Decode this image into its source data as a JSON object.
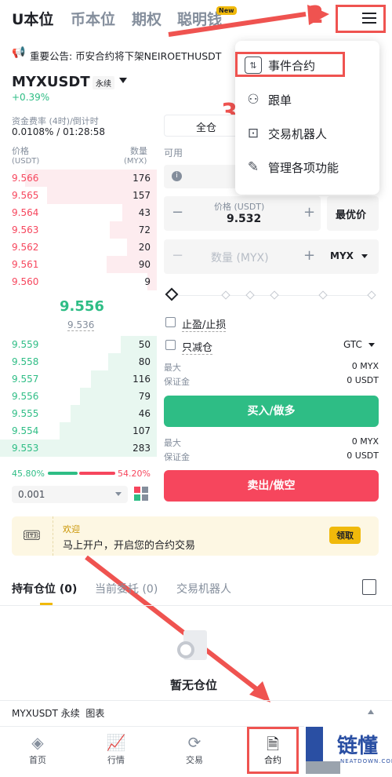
{
  "top_tabs": [
    "U本位",
    "币本位",
    "期权",
    "聪明钱"
  ],
  "new_badge": "New",
  "annotations": [
    "1",
    "2",
    "3"
  ],
  "notice": "重要公告: 币安合约将下架NEIROETHUSDT",
  "symbol": "MYXUSDT",
  "perp_label": "永续",
  "change": "+0.39%",
  "funding_label": "资金费率 (4时)/倒计时",
  "funding_value": "0.0108% / 01:28:58",
  "ob_headers": {
    "price": "价格",
    "price_unit": "(USDT)",
    "qty": "数量",
    "qty_unit": "(MYX)"
  },
  "asks": [
    [
      "9.566",
      "176"
    ],
    [
      "9.565",
      "157"
    ],
    [
      "9.564",
      "43"
    ],
    [
      "9.563",
      "72"
    ],
    [
      "9.562",
      "20"
    ],
    [
      "9.561",
      "90"
    ],
    [
      "9.560",
      "9"
    ]
  ],
  "last_price": "9.556",
  "mark_price": "9.536",
  "bids": [
    [
      "9.559",
      "50"
    ],
    [
      "9.558",
      "80"
    ],
    [
      "9.557",
      "116"
    ],
    [
      "9.556",
      "79"
    ],
    [
      "9.555",
      "46"
    ],
    [
      "9.554",
      "107"
    ],
    [
      "9.553",
      "283"
    ]
  ],
  "ratio": {
    "buy": "45.80%",
    "sell": "54.20%"
  },
  "precision": "0.001",
  "margin_mode": "全仓",
  "available_label": "可用",
  "price_input": {
    "label": "价格 (USDT)",
    "value": "9.532",
    "best": "最优价"
  },
  "qty_input": {
    "placeholder": "数量 (MYX)",
    "unit": "MYX"
  },
  "tpsl": "止盈/止损",
  "reduce_only": "只减仓",
  "tif": "GTC",
  "buy_info": {
    "max_label": "最大",
    "max_value": "0 MYX",
    "margin_label": "保证金",
    "margin_value": "0 USDT"
  },
  "sell_info": {
    "max_label": "最大",
    "max_value": "0 MYX",
    "margin_label": "保证金",
    "margin_value": "0 USDT"
  },
  "buy_button": "买入/做多",
  "sell_button": "卖出/做空",
  "menu": [
    "事件合约",
    "跟单",
    "交易机器人",
    "管理各项功能"
  ],
  "welcome": {
    "title": "欢迎",
    "text": "马上开户，开启您的合约交易",
    "button": "领取"
  },
  "positions_tabs": [
    "持有仓位 (0)",
    "当前委托 (0)",
    "交易机器人"
  ],
  "empty_text": "暂无仓位",
  "chart_bar": "MYXUSDT 永续  图表",
  "bottom_nav": [
    "首页",
    "行情",
    "交易",
    "合约"
  ],
  "watermark": {
    "cn": "链懂",
    "en": "NEATDOWN.COM"
  }
}
